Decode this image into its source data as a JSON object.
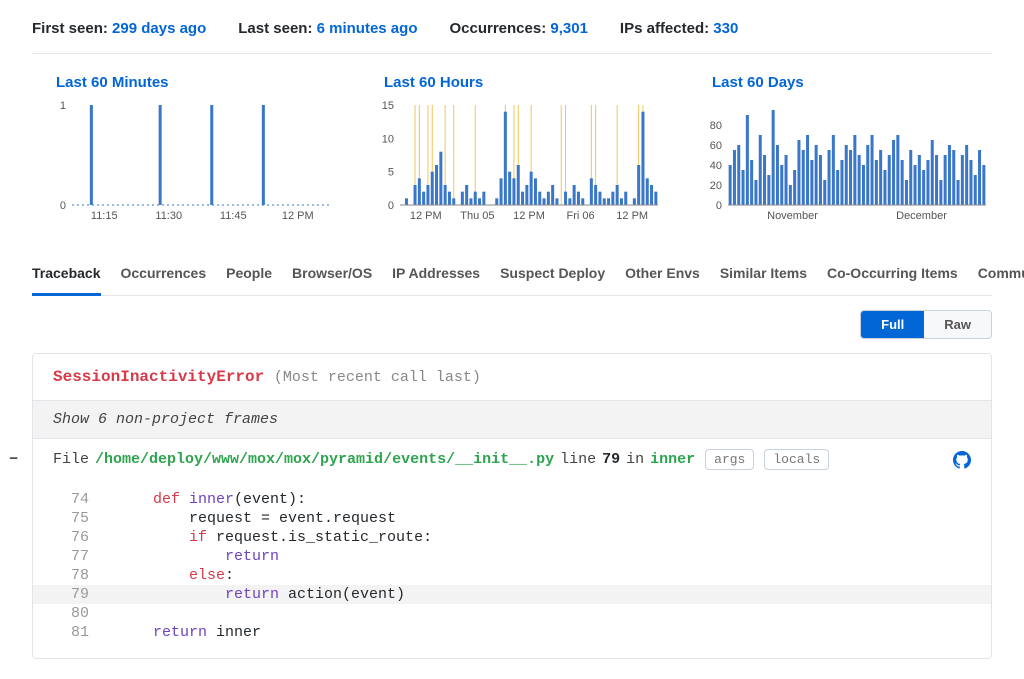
{
  "stats": {
    "first_seen_label": "First seen:",
    "first_seen_value": "299 days ago",
    "last_seen_label": "Last seen:",
    "last_seen_value": "6 minutes ago",
    "occurrences_label": "Occurrences:",
    "occurrences_value": "9,301",
    "ips_label": "IPs affected:",
    "ips_value": "330"
  },
  "charts": {
    "minutes": {
      "title": "Last 60 Minutes"
    },
    "hours": {
      "title": "Last 60 Hours"
    },
    "days": {
      "title": "Last 60 Days"
    }
  },
  "chart_data": [
    {
      "type": "bar",
      "title": "Last 60 Minutes",
      "categories_sample": [
        "11:15",
        "11:30",
        "11:45",
        "12 PM"
      ],
      "values": [
        0,
        0,
        0,
        0,
        1,
        0,
        0,
        0,
        0,
        0,
        0,
        0,
        0,
        0,
        0,
        0,
        0,
        0,
        0,
        0,
        1,
        0,
        0,
        0,
        0,
        0,
        0,
        0,
        0,
        0,
        0,
        0,
        1,
        0,
        0,
        0,
        0,
        0,
        0,
        0,
        0,
        0,
        0,
        0,
        1,
        0,
        0,
        0,
        0,
        0,
        0,
        0,
        0,
        0,
        0,
        0,
        0,
        0,
        0,
        0
      ],
      "ylim": [
        0,
        1
      ],
      "yticks": [
        0,
        1
      ],
      "xticks": [
        "11:15",
        "11:30",
        "11:45",
        "12 PM"
      ]
    },
    {
      "type": "bar",
      "title": "Last 60 Hours",
      "values": [
        0,
        1,
        0,
        3,
        4,
        2,
        3,
        5,
        6,
        8,
        3,
        2,
        1,
        0,
        2,
        3,
        1,
        2,
        1,
        2,
        0,
        0,
        1,
        4,
        14,
        5,
        4,
        6,
        2,
        3,
        5,
        4,
        2,
        1,
        2,
        3,
        1,
        0,
        2,
        1,
        3,
        2,
        1,
        0,
        4,
        3,
        2,
        1,
        1,
        2,
        3,
        1,
        2,
        0,
        1,
        6,
        14,
        4,
        3,
        2
      ],
      "ylim": [
        0,
        15
      ],
      "yticks": [
        0,
        5,
        10,
        15
      ],
      "xticks": [
        "12 PM",
        "Thu 05",
        "12 PM",
        "Fri 06",
        "12 PM"
      ],
      "deploy_markers": [
        3,
        4,
        6,
        7,
        10,
        12,
        17,
        24,
        26,
        27,
        30,
        37,
        38,
        44,
        45,
        50,
        55,
        56
      ]
    },
    {
      "type": "bar",
      "title": "Last 60 Days",
      "values": [
        40,
        55,
        60,
        35,
        90,
        45,
        25,
        70,
        50,
        30,
        95,
        60,
        40,
        50,
        20,
        35,
        65,
        55,
        70,
        45,
        60,
        50,
        25,
        55,
        70,
        35,
        45,
        60,
        55,
        70,
        50,
        40,
        60,
        70,
        45,
        55,
        35,
        50,
        65,
        70,
        45,
        25,
        55,
        40,
        50,
        35,
        45,
        65,
        50,
        25,
        50,
        60,
        55,
        25,
        50,
        60,
        45,
        30,
        55,
        40
      ],
      "ylim": [
        0,
        100
      ],
      "yticks": [
        0,
        20,
        40,
        60,
        80
      ],
      "xticks": [
        "November",
        "December"
      ]
    }
  ],
  "tabs": [
    "Traceback",
    "Occurrences",
    "People",
    "Browser/OS",
    "IP Addresses",
    "Suspect Deploy",
    "Other Envs",
    "Similar Items",
    "Co-Occurring Items",
    "Community Solutions"
  ],
  "active_tab": "Traceback",
  "view_toggle": {
    "full": "Full",
    "raw": "Raw"
  },
  "traceback": {
    "error_class": "SessionInactivityError",
    "most_recent": "(Most recent call last)",
    "show_frames": "Show 6 non-project frames",
    "frame": {
      "file_label": "File",
      "path": "/home/deploy/www/mox/mox/pyramid/events/__init__.py",
      "line_label": "line",
      "line_no": "79",
      "in_label": "in",
      "func": "inner",
      "args_btn": "args",
      "locals_btn": "locals"
    },
    "code": {
      "l74": {
        "n": "74",
        "def": "def ",
        "name": "inner",
        "rest": "(event):"
      },
      "l75": {
        "n": "75",
        "text": "        request = event.request"
      },
      "l76": {
        "n": "76",
        "kw": "        if ",
        "rest": "request.is_static_route:"
      },
      "l77": {
        "n": "77",
        "ret": "            return"
      },
      "l78": {
        "n": "78",
        "kw": "        else",
        "rest": ":"
      },
      "l79": {
        "n": "79",
        "ret": "            return ",
        "rest": "action(event)"
      },
      "l80": {
        "n": "80",
        "text": ""
      },
      "l81": {
        "n": "81",
        "ret": "    return ",
        "rest": "inner"
      }
    }
  }
}
